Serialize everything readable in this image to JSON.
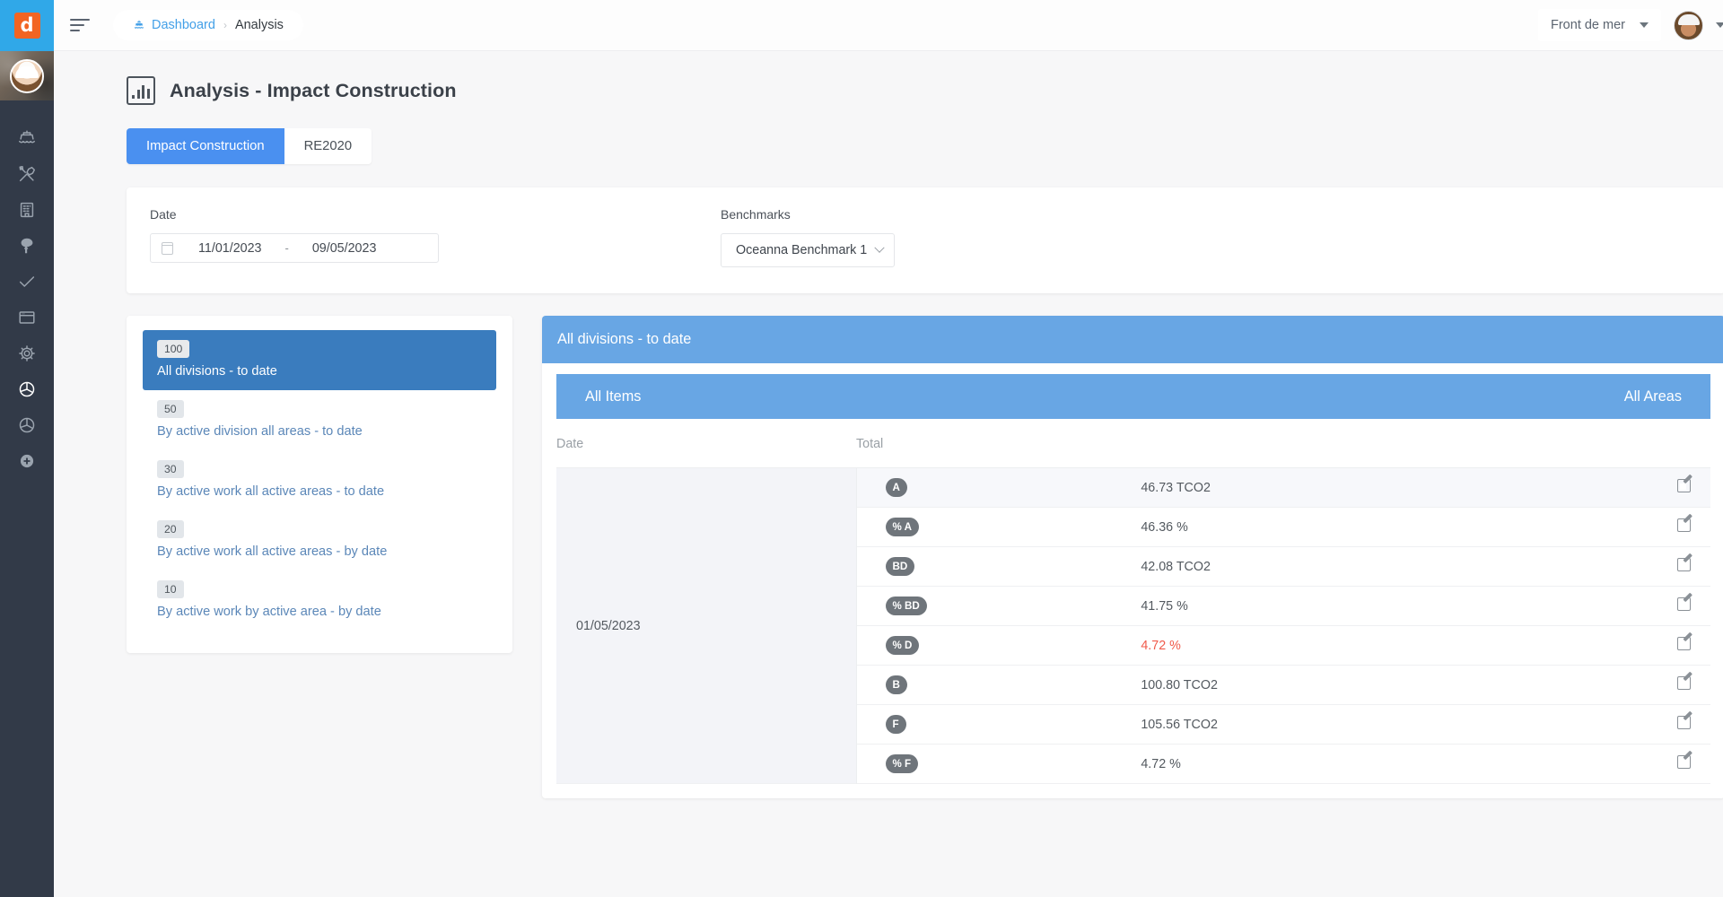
{
  "sidebar": {
    "logo_letter": "d",
    "items": [
      {
        "icon": "ship-icon",
        "name": "sidebar-item-ship",
        "active": false
      },
      {
        "icon": "tools-icon",
        "name": "sidebar-item-tools",
        "active": false
      },
      {
        "icon": "building-icon",
        "name": "sidebar-item-building",
        "active": false
      },
      {
        "icon": "tree-icon",
        "name": "sidebar-item-tree",
        "active": false
      },
      {
        "icon": "check-icon",
        "name": "sidebar-item-check",
        "active": false
      },
      {
        "icon": "browser-window-icon",
        "name": "sidebar-item-browser",
        "active": false
      },
      {
        "icon": "gear-icon",
        "name": "sidebar-item-settings",
        "active": false
      },
      {
        "icon": "pie-chart-icon",
        "name": "sidebar-item-analysis",
        "active": true
      },
      {
        "icon": "pie-chart-icon",
        "name": "sidebar-item-reports",
        "active": false
      },
      {
        "icon": "plus-circle-icon",
        "name": "sidebar-item-add",
        "active": false
      }
    ]
  },
  "topbar": {
    "breadcrumb": {
      "root": "Dashboard",
      "separator": "›",
      "current": "Analysis"
    },
    "company": "Front de mer"
  },
  "page": {
    "title": "Analysis - Impact Construction",
    "tabs": [
      {
        "label": "Impact Construction",
        "active": true
      },
      {
        "label": "RE2020",
        "active": false
      }
    ]
  },
  "filters": {
    "date": {
      "label": "Date",
      "start": "11/01/2023",
      "separator": "-",
      "end": "09/05/2023"
    },
    "benchmarks": {
      "label": "Benchmarks",
      "selected": "Oceanna Benchmark 1"
    }
  },
  "analysis_list": [
    {
      "num": "100",
      "label": "All divisions - to date",
      "active": true
    },
    {
      "num": "50",
      "label": "By active division all areas - to date",
      "active": false
    },
    {
      "num": "30",
      "label": "By active work all active areas - to date",
      "active": false
    },
    {
      "num": "20",
      "label": "By active work all active areas - by date",
      "active": false
    },
    {
      "num": "10",
      "label": "By active work by active area - by date",
      "active": false
    }
  ],
  "result": {
    "banner": "All divisions - to date",
    "inner_left": "All Items",
    "inner_right": "All Areas",
    "columns": {
      "date": "Date",
      "total": "Total"
    },
    "date_value": "01/05/2023",
    "rows": [
      {
        "badge": "A",
        "value": "46.73 TCO2",
        "negative": false
      },
      {
        "badge": "% A",
        "value": "46.36 %",
        "negative": false
      },
      {
        "badge": "BD",
        "value": "42.08 TCO2",
        "negative": false
      },
      {
        "badge": "% BD",
        "value": "41.75 %",
        "negative": false
      },
      {
        "badge": "% D",
        "value": "4.72 %",
        "negative": true
      },
      {
        "badge": "B",
        "value": "100.80 TCO2",
        "negative": false
      },
      {
        "badge": "F",
        "value": "105.56 TCO2",
        "negative": false
      },
      {
        "badge": "% F",
        "value": "4.72 %",
        "negative": false
      }
    ]
  },
  "colors": {
    "accent_blue": "#4a90f0",
    "banner_blue": "#68a6e4",
    "active_list_blue": "#3a7cbe",
    "sidebar_dark": "#323a48",
    "logo_orange": "#f26422",
    "logo_bg_blue": "#30a8e8",
    "negative_red": "#f05b4b",
    "badge_gray": "#6f757b"
  }
}
